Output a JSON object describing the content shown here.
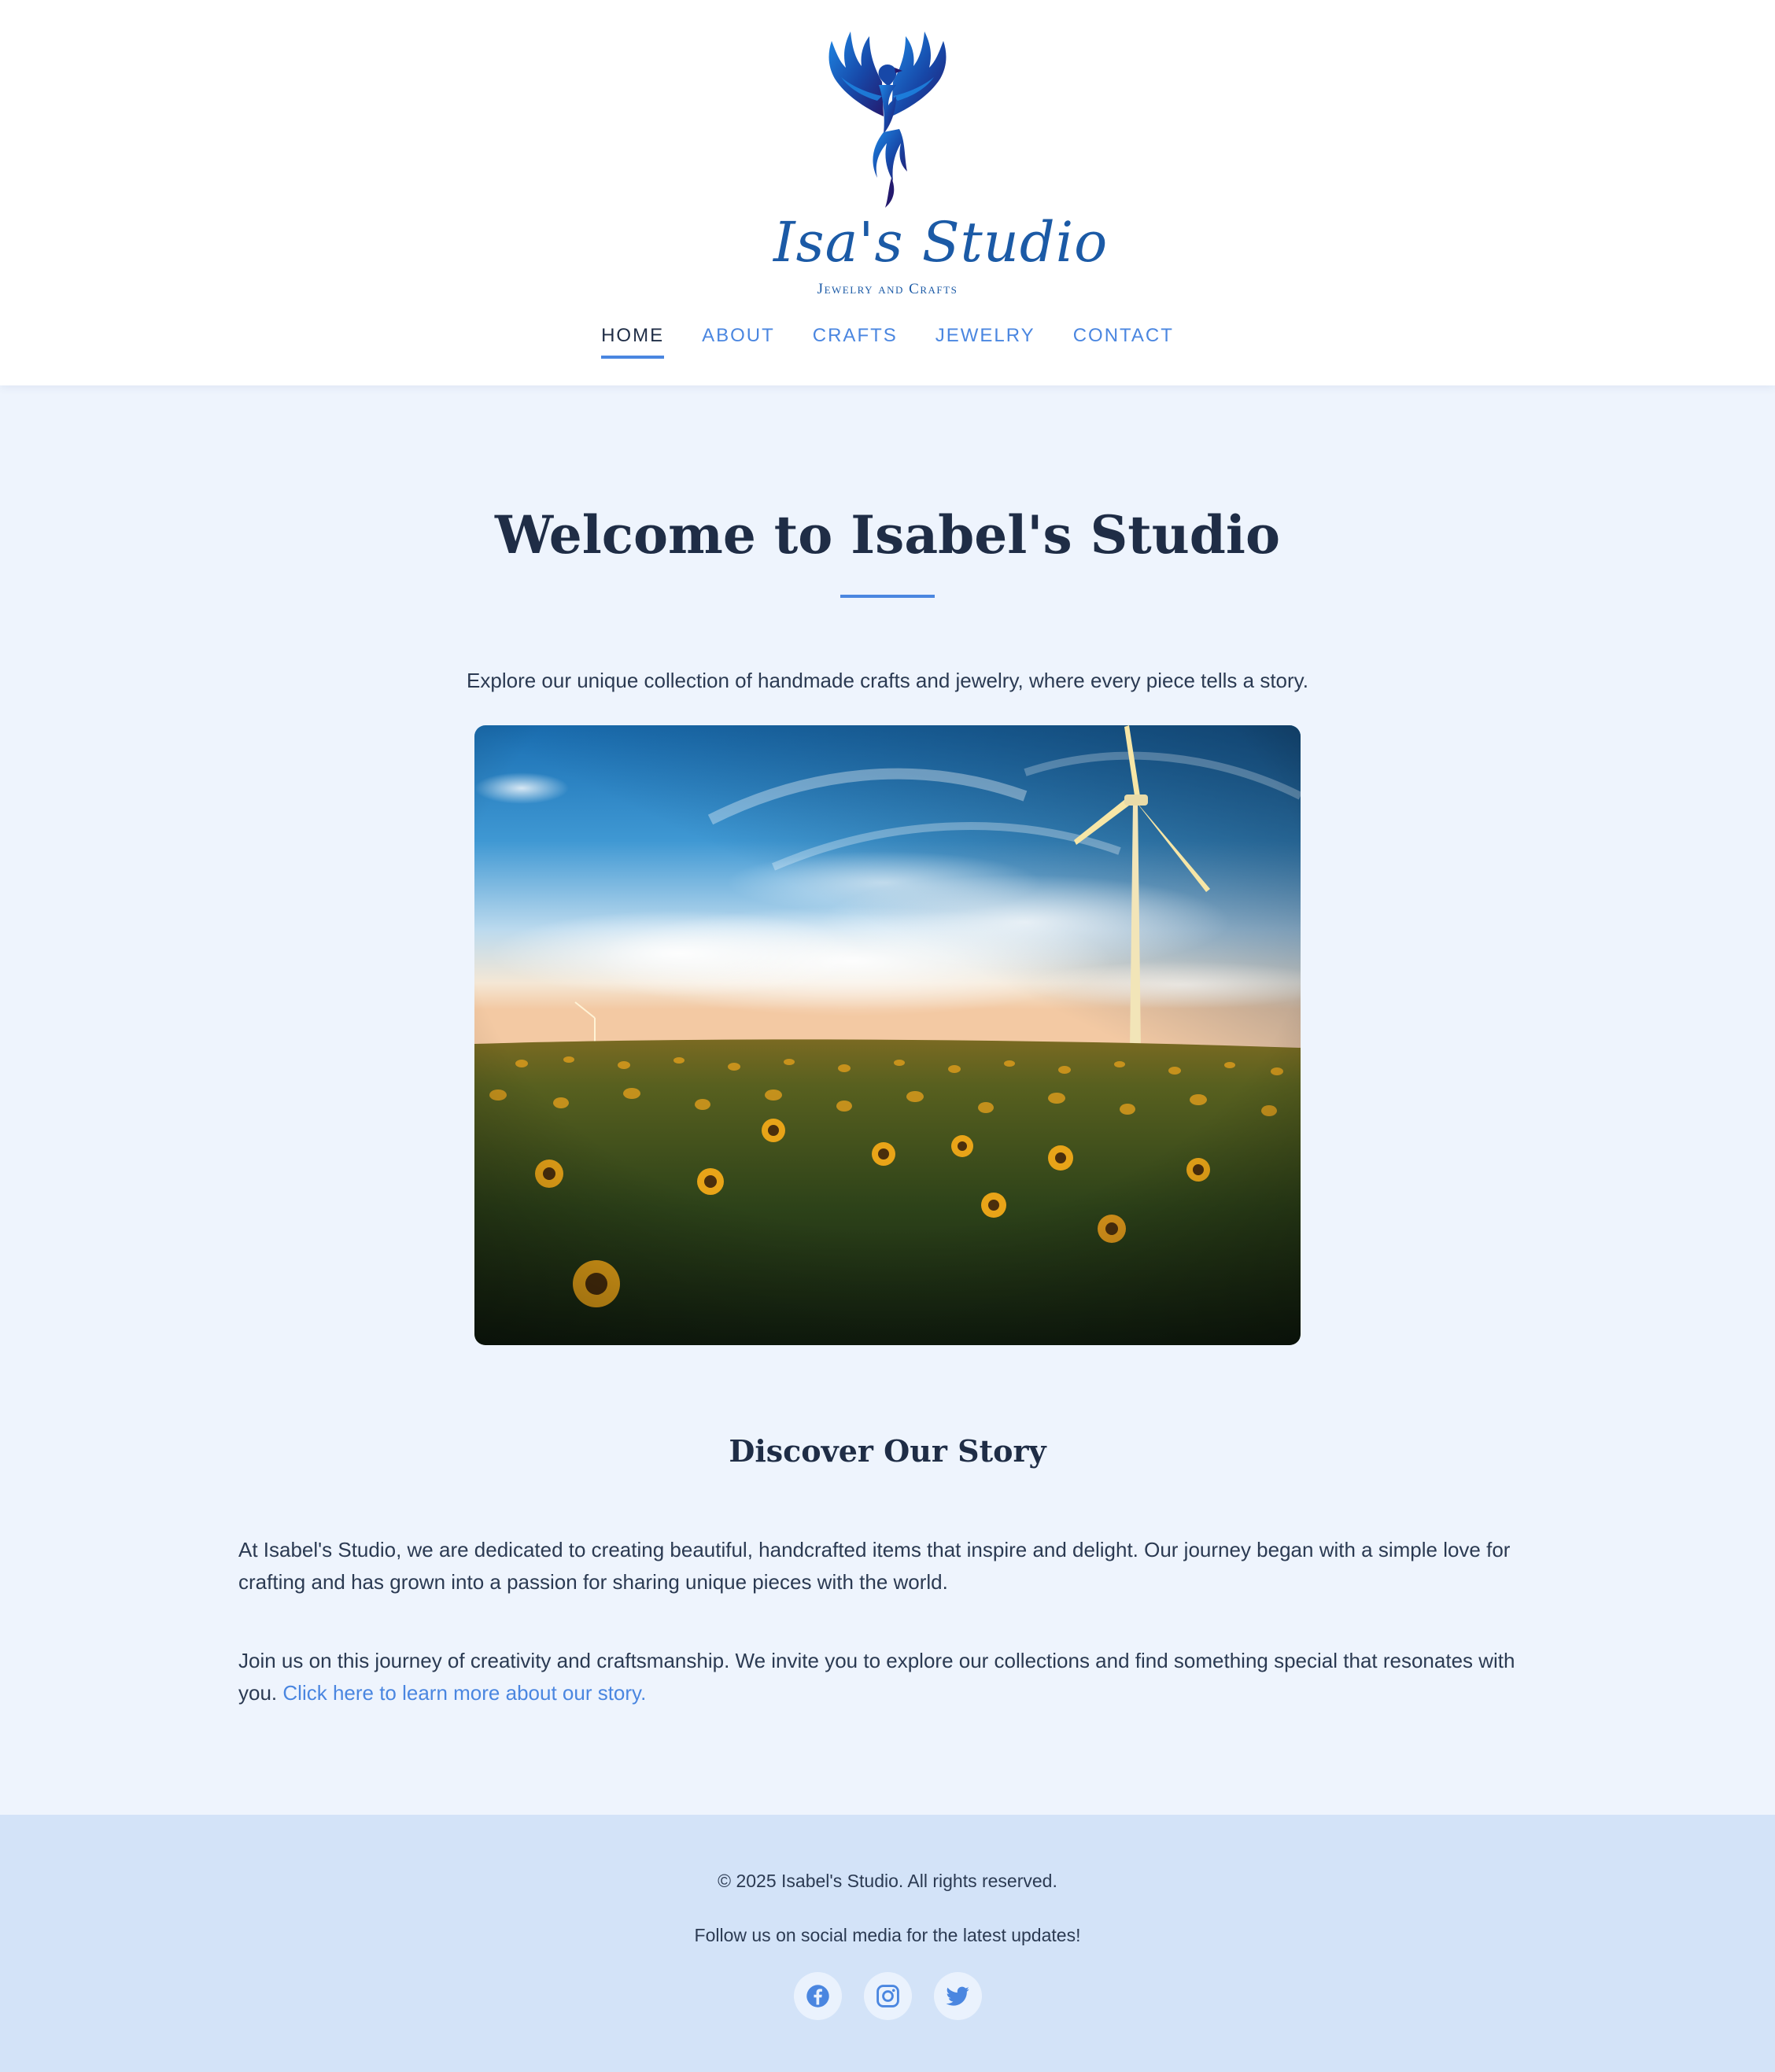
{
  "brand": {
    "name": "Isa's Studio",
    "tagline": "Jewelry and Crafts"
  },
  "nav": {
    "items": [
      {
        "label": "HOME",
        "active": true
      },
      {
        "label": "ABOUT",
        "active": false
      },
      {
        "label": "CRAFTS",
        "active": false
      },
      {
        "label": "JEWELRY",
        "active": false
      },
      {
        "label": "CONTACT",
        "active": false
      }
    ]
  },
  "hero": {
    "title": "Welcome to Isabel's Studio",
    "intro": "Explore our unique collection of handmade crafts and jewelry, where every piece tells a story."
  },
  "story": {
    "title": "Discover Our Story",
    "paragraph1": "At Isabel's Studio, we are dedicated to creating beautiful, handcrafted items that inspire and delight. Our journey began with a simple love for crafting and has grown into a passion for sharing unique pieces with the world.",
    "paragraph2": "Join us on this journey of creativity and craftsmanship. We invite you to explore our collections and find something special that resonates with you.",
    "link_text": "Click here to learn more about our story."
  },
  "footer": {
    "copyright": "© 2025 Isabel's Studio. All rights reserved.",
    "follow": "Follow us on social media for the latest updates!",
    "social": [
      {
        "icon": "facebook-icon"
      },
      {
        "icon": "instagram-icon"
      },
      {
        "icon": "twitter-icon"
      }
    ]
  },
  "colors": {
    "accent": "#4a86e0",
    "heading": "#1f2d46",
    "page_background": "#eef4fd",
    "footer_background": "#d3e3f8",
    "logo_blue": "#1b5aa6"
  }
}
